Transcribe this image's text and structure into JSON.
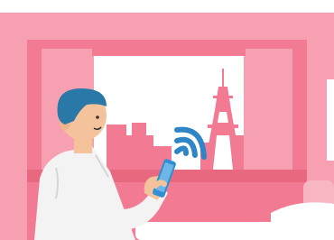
{
  "scene": {
    "subject": "person-using-smartphone-wifi",
    "colors": {
      "wall": "#f27a93",
      "wall_light": "#f6a0b2",
      "wall_dark": "#e8687f",
      "window_sky": "#ffffff",
      "skyline": "#f27a93",
      "hair": "#2a78a8",
      "skin": "#f4c39c",
      "shirt": "#f3f3f3",
      "phone": "#2f8fd1",
      "wifi": "#2f86c6",
      "bed": "#f8b6c3"
    },
    "icons": {
      "wifi": "wifi-signal-icon",
      "phone": "smartphone-icon",
      "tower": "tokyo-tower-icon"
    }
  }
}
